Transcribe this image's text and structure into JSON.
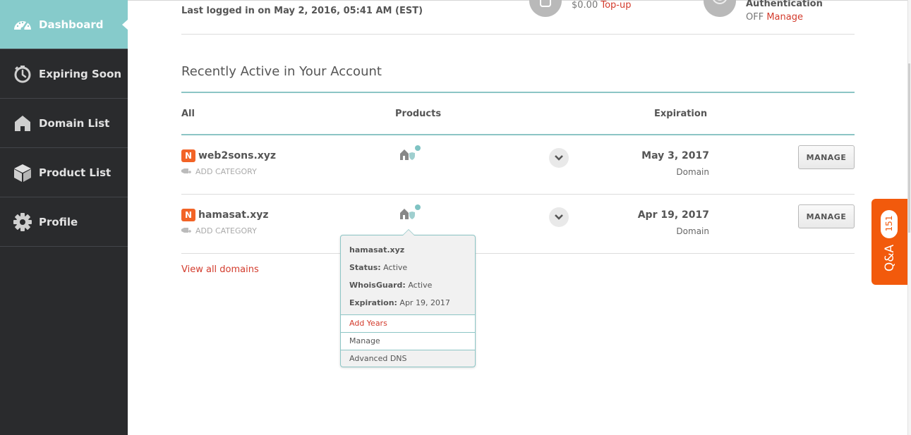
{
  "sidebar": {
    "items": [
      {
        "label": "Dashboard",
        "icon": "speedometer-icon",
        "active": true
      },
      {
        "label": "Expiring Soon",
        "icon": "stopwatch-icon",
        "active": false
      },
      {
        "label": "Domain List",
        "icon": "house-icon",
        "active": false
      },
      {
        "label": "Product List",
        "icon": "box-icon",
        "active": false
      },
      {
        "label": "Profile",
        "icon": "gear-icon",
        "active": false
      }
    ]
  },
  "header": {
    "last_logged": "Last logged in on May 2, 2016, 05:41 AM (EST)",
    "balance_amount": "$0.00",
    "balance_action": "Top-up",
    "auth_title": "Authentication",
    "auth_state": "OFF",
    "auth_action": "Manage"
  },
  "section": {
    "title": "Recently Active in Your Account",
    "columns": {
      "all": "All",
      "products": "Products",
      "expiration": "Expiration"
    }
  },
  "rows": [
    {
      "domain": "web2sons.xyz",
      "add_category": "ADD CATEGORY",
      "exp_date": "May 3, 2017",
      "exp_type": "Domain",
      "manage": "MANAGE"
    },
    {
      "domain": "hamasat.xyz",
      "add_category": "ADD CATEGORY",
      "exp_date": "Apr 19, 2017",
      "exp_type": "Domain",
      "manage": "MANAGE"
    }
  ],
  "view_all": "View all domains",
  "popover": {
    "domain": "hamasat.xyz",
    "status_label": "Status:",
    "status_value": "Active",
    "whois_label": "WhoisGuard:",
    "whois_value": "Active",
    "exp_label": "Expiration:",
    "exp_value": "Apr 19, 2017",
    "actions": [
      "Add Years",
      "Manage",
      "Advanced DNS"
    ]
  },
  "qa": {
    "count": "151",
    "label": "Q&A"
  },
  "colors": {
    "accent": "#86cbcb",
    "link": "#d33b2c",
    "brand": "#f26326",
    "qa": "#f25a0c"
  }
}
